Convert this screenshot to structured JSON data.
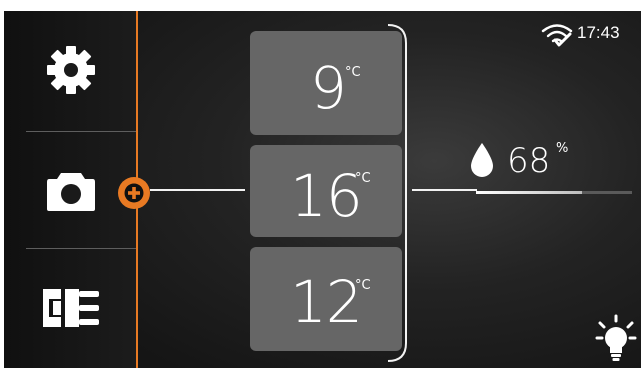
{
  "status_bar": {
    "time": "17:43",
    "wifi_icon": "wifi-icon"
  },
  "sidebar": {
    "items": [
      {
        "name": "settings",
        "icon": "gear-icon"
      },
      {
        "name": "camera",
        "icon": "camera-icon"
      },
      {
        "name": "connections",
        "icon": "plug-icon"
      }
    ],
    "add_button_icon": "plus-icon"
  },
  "temperatures": [
    {
      "value": "9",
      "unit": "°C"
    },
    {
      "value": "16",
      "unit": "°C"
    },
    {
      "value": "12",
      "unit": "°C"
    }
  ],
  "humidity": {
    "value": "68",
    "unit": "%",
    "level": 0.68,
    "icon": "droplet-icon"
  },
  "light_button_icon": "light-bulb-icon",
  "colors": {
    "accent": "#e87a23",
    "card": "#666666",
    "text": "#ffffff"
  }
}
